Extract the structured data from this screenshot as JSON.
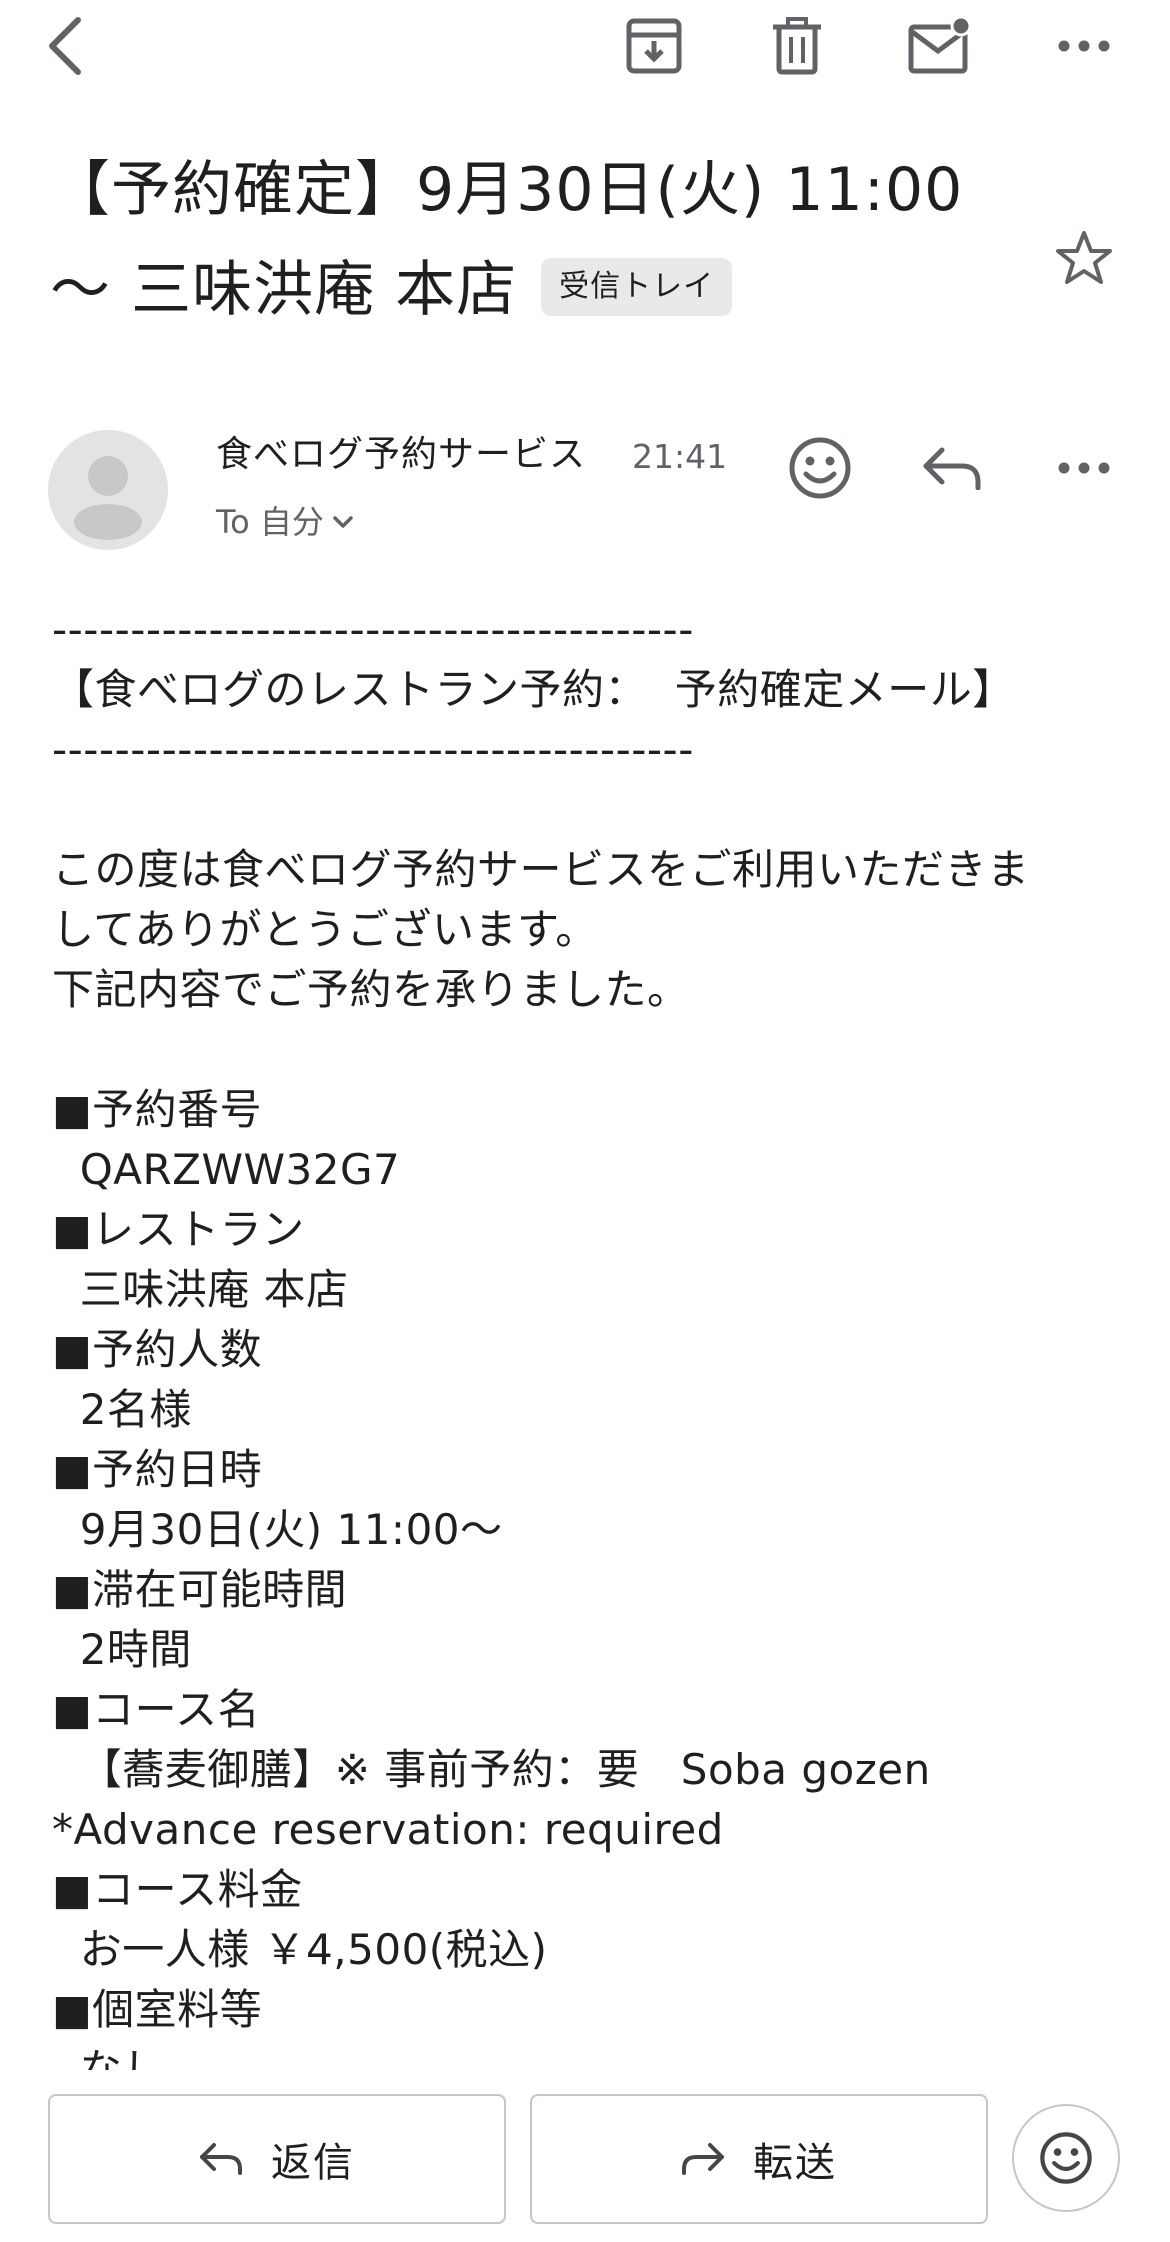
{
  "toolbar": {
    "back_icon": "back-arrow-icon",
    "archive_icon": "archive-icon",
    "delete_icon": "trash-icon",
    "mark_unread_icon": "mail-unread-icon",
    "more_icon": "more-horizontal-icon"
  },
  "subject": {
    "title": "【予約確定】9月30日(火) 11:00 〜 三味洪庵 本店",
    "label": "受信トレイ"
  },
  "sender": {
    "name": "食べログ予約サービス",
    "time": "21:41",
    "recipient": "To 自分"
  },
  "body_text": "-----------------------------------------\n【食べログのレストラン予約：  予約確定メール】\n-----------------------------------------\n\nこの度は食べログ予約サービスをご利用いただきま\nしてありがとうございます。\n下記内容でご予約を承りました。\n\n■予約番号\n  QARZWW32G7\n■レストラン\n  三味洪庵 本店\n■予約人数\n  2名様\n■予約日時\n  9月30日(火) 11:00〜\n■滞在可能時間\n  2時間\n■コース名\n  【蕎麦御膳】※ 事前予約：要   Soba gozen\n*Advance reservation: required\n■コース料金\n  お一人様 ￥4,500(税込)\n■個室料等\n  なし",
  "actions": {
    "reply_label": "返信",
    "forward_label": "転送"
  },
  "colors": {
    "text": "#1f1f1f",
    "secondary": "#5f6368",
    "icon": "#5f6368",
    "chip_bg": "#e9e9e9",
    "border": "#c4c7c5"
  }
}
